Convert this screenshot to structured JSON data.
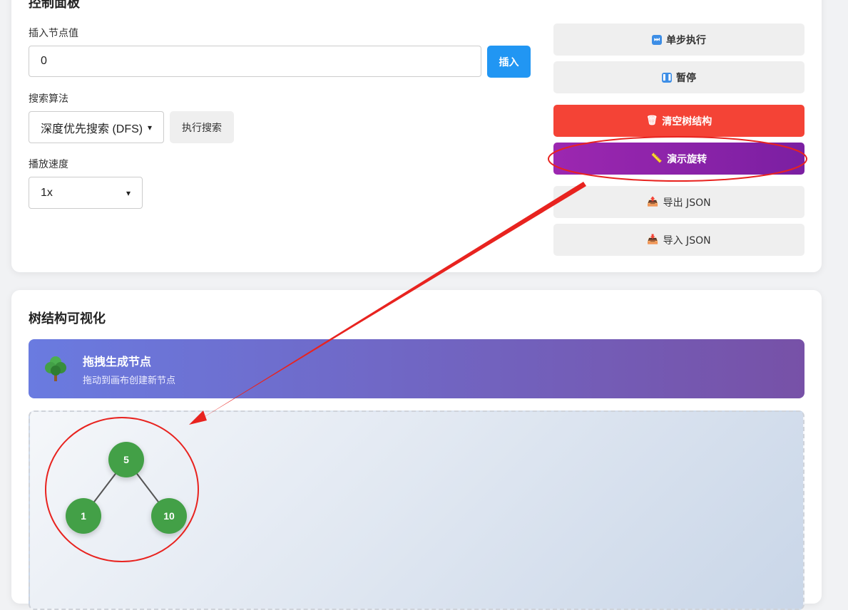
{
  "control": {
    "title": "控制面板",
    "insert_label": "插入节点值",
    "insert_value": "0",
    "insert_button": "插入",
    "search_label": "搜索算法",
    "search_selected": "深度优先搜索 (DFS)",
    "search_button": "执行搜索",
    "speed_label": "播放速度",
    "speed_selected": "1x",
    "actions": {
      "step": "单步执行",
      "pause": "暂停",
      "clear": "清空树结构",
      "rotate": "演示旋转",
      "export": "导出 JSON",
      "import": "导入 JSON"
    }
  },
  "viz": {
    "title": "树结构可视化",
    "banner_title": "拖拽生成节点",
    "banner_subtitle": "拖动到画布创建新节点",
    "nodes": [
      "5",
      "1",
      "10"
    ]
  },
  "colors": {
    "primary_blue": "#2196f3",
    "danger_red": "#f44336",
    "purple": "#9c27b0",
    "node_green": "#43a047",
    "annotation_red": "#e8231f"
  },
  "icons": {
    "step": "fast-forward-icon",
    "pause": "pause-icon",
    "clear": "trash-icon",
    "rotate": "ruler-icon",
    "export": "export-icon",
    "import": "import-icon",
    "banner": "tree-icon"
  }
}
